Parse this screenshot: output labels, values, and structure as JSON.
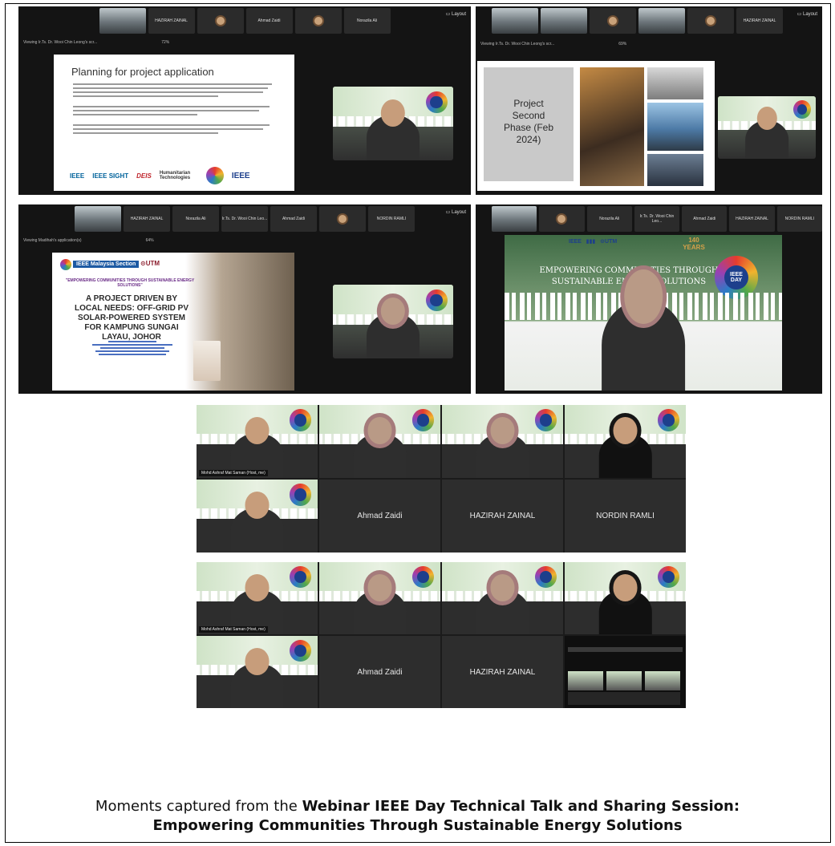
{
  "panel1": {
    "participants": [
      "HAZIRAH ZAINAL",
      "Ahmad Zaidi",
      "Norazila Ali"
    ],
    "layout_label": "Layout",
    "viewing": "Viewing Ir.Ts. Dr. Wooi Chin Leong's scr...",
    "zoom": "72%",
    "slide_title": "Planning for project application",
    "logos": [
      "IEEE",
      "IEEE SIGHT",
      "DEIS",
      "Humanitarian Technologies",
      "IEEE"
    ]
  },
  "panel2": {
    "participants": [
      "HAZIRAH ZAINAL"
    ],
    "layout_label": "Layout",
    "viewing": "Viewing Ir.Ts. Dr. Wooi Chin Leong's scr...",
    "zoom": "69%",
    "slide_title": "Project Second Phase (Feb 2024)"
  },
  "panel3": {
    "participants": [
      "HAZIRAH ZAINAL",
      "Norazila Ali",
      "Ir.Ts. Dr. Wooi Chin Leo...",
      "Ahmad Zaidi",
      "NORDIN RAMLI"
    ],
    "layout_label": "Layout",
    "viewing": "Viewing Madihah's application(s)",
    "zoom": "64%",
    "slide_header": "IEEE Malaysia Section",
    "slide_quote": "\"EMPOWERING COMMUNITIES THROUGH SUSTAINABLE ENERGY SOLUTIONS\"",
    "slide_title": "A PROJECT DRIVEN BY LOCAL NEEDS: OFF-GRID PV SOLAR-POWERED SYSTEM FOR KAMPUNG SUNGAI LAYAU, JOHOR"
  },
  "panel4": {
    "participants": [
      "Norazila Ali",
      "Ir.Ts. Dr. Wooi Chin Leo...",
      "Ahmad Zaidi",
      "HAZIRAH ZAINAL",
      "NORDIN RAMLI"
    ],
    "banner_text": "EMPOWERING COMMUNITIES THROUGH SUSTAINABLE ENERGY SOLUTIONS",
    "badge_text": "IEEE DAY",
    "years_text": "140 YEARS"
  },
  "gallery1": {
    "host_label": "Mohd Ashraf Mat Saman (Host, me)",
    "empty_names": [
      "Ahmad Zaidi",
      "HAZIRAH ZAINAL",
      "NORDIN RAMLI"
    ]
  },
  "gallery2": {
    "host_label": "Mohd Ashraf Mat Saman (Host, me)",
    "empty_names": [
      "Ahmad Zaidi",
      "HAZIRAH ZAINAL"
    ]
  },
  "caption": {
    "prefix": "Moments captured from the ",
    "bold_line1": "Webinar IEEE Day Technical Talk and Sharing Session:",
    "bold_line2": "Empowering Communities Through Sustainable Energy Solutions"
  }
}
